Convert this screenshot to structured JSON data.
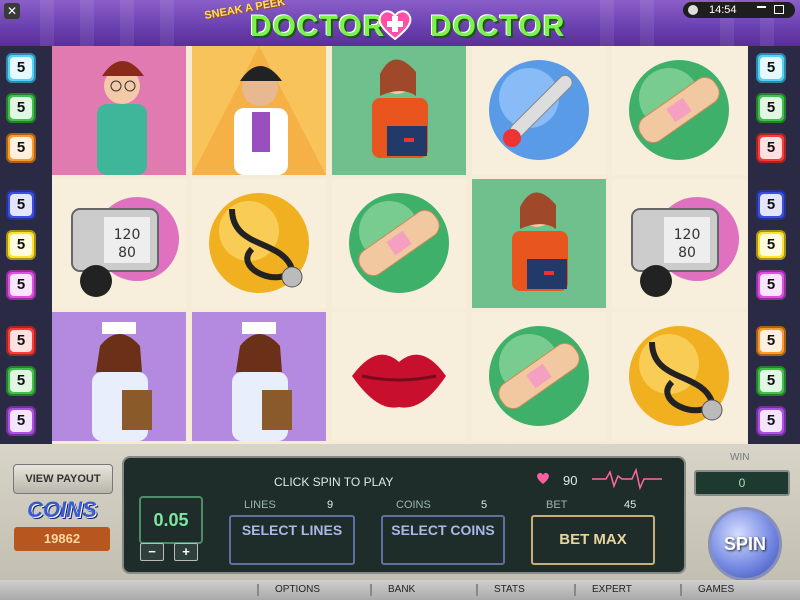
{
  "window": {
    "close_label": "✕",
    "time": "14:54"
  },
  "logo": {
    "tagline": "SNEAK A PEEK",
    "word_left": "DOCTOR",
    "word_right": "DOCTOR"
  },
  "paylines": {
    "left": [
      {
        "label": "5",
        "color": "#4fd3ff"
      },
      {
        "label": "5",
        "color": "#3fc24a"
      },
      {
        "label": "5",
        "color": "#ff9a2a"
      },
      {
        "label": "5",
        "color": "#3c4fe0"
      },
      {
        "label": "5",
        "color": "#ffe22a"
      },
      {
        "label": "5",
        "color": "#e14fe8"
      },
      {
        "label": "5",
        "color": "#ff3a3a"
      },
      {
        "label": "5",
        "color": "#3fc24a"
      },
      {
        "label": "5",
        "color": "#b04fe8"
      }
    ],
    "right": [
      {
        "label": "5",
        "color": "#4fd3ff"
      },
      {
        "label": "5",
        "color": "#3fc24a"
      },
      {
        "label": "5",
        "color": "#ff3a3a"
      },
      {
        "label": "5",
        "color": "#3c4fe0"
      },
      {
        "label": "5",
        "color": "#ffe22a"
      },
      {
        "label": "5",
        "color": "#e14fe8"
      },
      {
        "label": "5",
        "color": "#ff9a2a"
      },
      {
        "label": "5",
        "color": "#3fc24a"
      },
      {
        "label": "5",
        "color": "#b04fe8"
      }
    ]
  },
  "reels": [
    [
      "surgeon-nurse",
      "bp-monitor",
      "nurse-clipboard"
    ],
    [
      "doctor-stethoscope",
      "stethoscope",
      "nurse-clipboard"
    ],
    [
      "paramedic",
      "bandage",
      "lips"
    ],
    [
      "thermometer",
      "paramedic",
      "bandage"
    ],
    [
      "bandage",
      "bp-monitor",
      "stethoscope"
    ]
  ],
  "controls": {
    "view_payout": "VIEW PAYOUT",
    "coins_logo": "COINS",
    "coins_value": "19862",
    "message": "CLICK SPIN TO PLAY",
    "hearts_value": "90",
    "lines_label": "LINES",
    "lines_value": "9",
    "coins_label": "COINS",
    "coins_bet_value": "5",
    "bet_label": "BET",
    "bet_value": "45",
    "coin_size": "0.05",
    "minus": "−",
    "plus": "+",
    "select_lines": "SELECT LINES",
    "select_coins": "SELECT COINS",
    "bet_max": "BET MAX",
    "win_label": "WIN",
    "win_value": "0",
    "spin": "SPIN"
  },
  "menu": [
    "OPTIONS",
    "BANK",
    "STATS",
    "EXPERT",
    "GAMES"
  ]
}
